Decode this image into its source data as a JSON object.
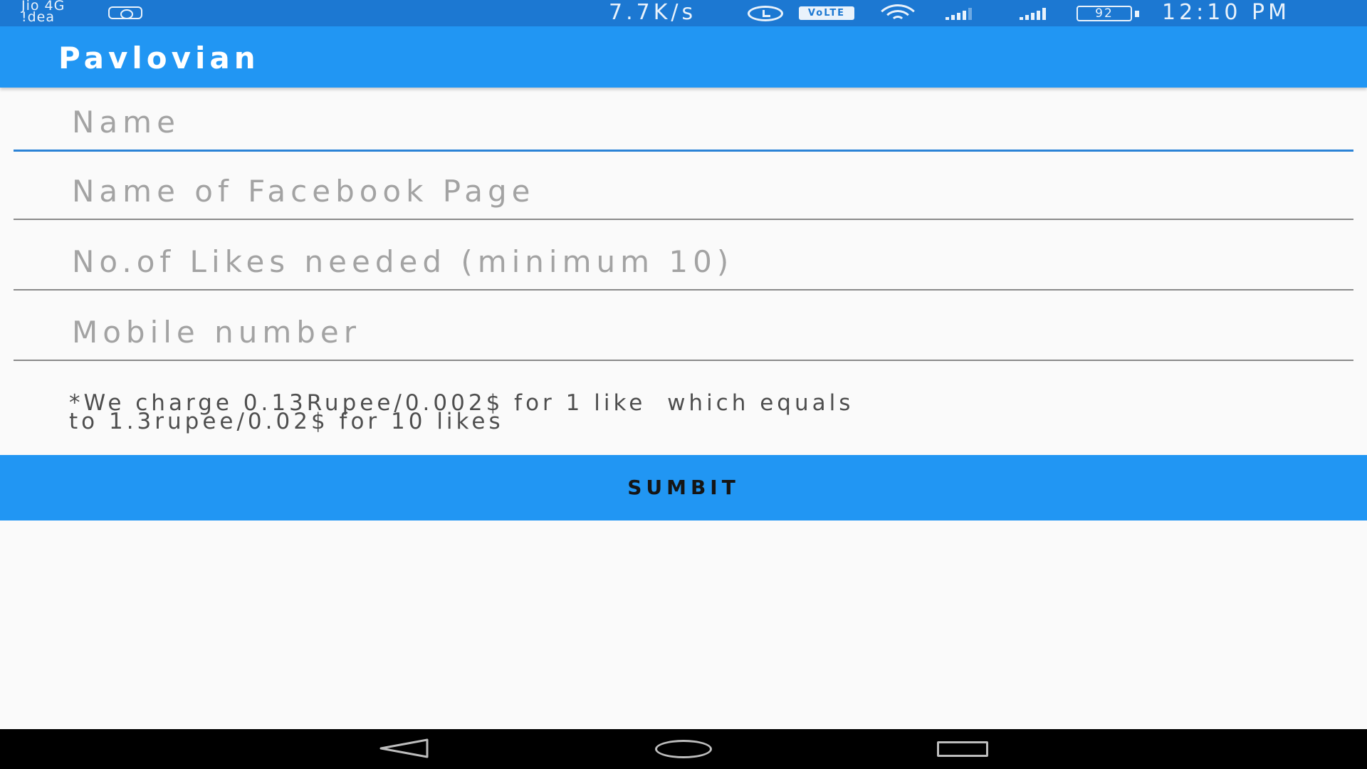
{
  "status_bar": {
    "carrier_1": "Jio 4G",
    "carrier_2": "!dea",
    "net_speed": "7.7K/s",
    "volte": "VoLTE",
    "battery": "92",
    "time": "12:10 PM",
    "icons": [
      "instagram-icon",
      "alarm-icon",
      "volte-icon",
      "wifi-icon",
      "signal-icon",
      "battery-icon"
    ]
  },
  "app_bar": {
    "title": "Pavlovian",
    "color": "#2196f3"
  },
  "form": {
    "name_placeholder": "Name",
    "page_placeholder": "Name of Facebook Page",
    "likes_placeholder": "No.of Likes needed (minimum 10)",
    "mobile_placeholder": "Mobile number",
    "focus_color": "#2b83d6"
  },
  "note": {
    "line1": "*We charge 0.13Rupee/0.002$ for 1 like  which equals",
    "line2": "to 1.3rupee/0.02$ for 10 likes"
  },
  "submit_label": "SUMBIT",
  "nav_bar": {
    "icons": [
      "back-icon",
      "home-icon",
      "recents-icon"
    ]
  }
}
